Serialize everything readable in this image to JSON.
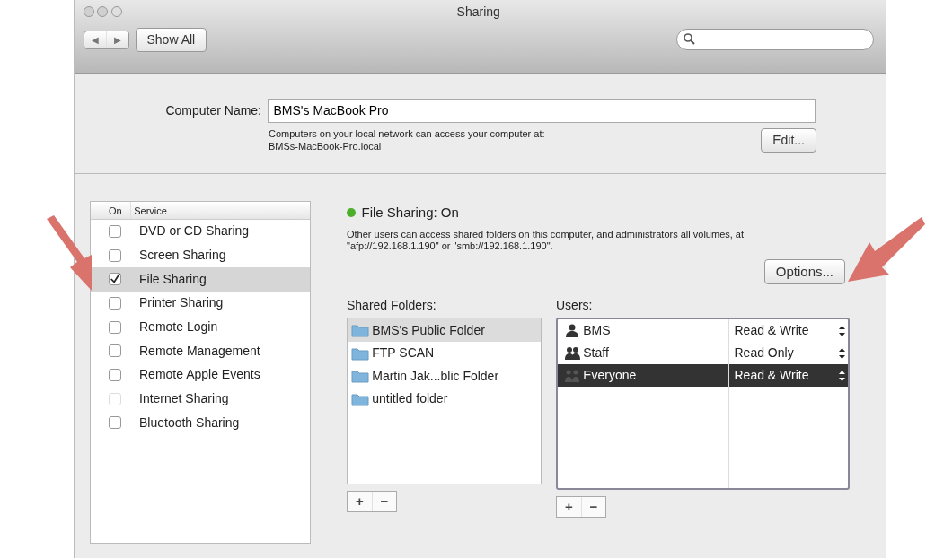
{
  "window": {
    "title": "Sharing"
  },
  "toolbar": {
    "back": "◀",
    "forward": "▶",
    "show_all": "Show All"
  },
  "computer_name": {
    "label": "Computer Name:",
    "value": "BMS's MacBook Pro",
    "note": "Computers on your local network can access your computer at:",
    "address": "BMSs-MacBook-Pro.local",
    "edit": "Edit..."
  },
  "services": {
    "columns": [
      "On",
      "Service"
    ],
    "items": [
      {
        "name": "DVD or CD Sharing",
        "checked": false,
        "selected": false,
        "disabled": false
      },
      {
        "name": "Screen Sharing",
        "checked": false,
        "selected": false,
        "disabled": false
      },
      {
        "name": "File Sharing",
        "checked": true,
        "selected": true,
        "disabled": false
      },
      {
        "name": "Printer Sharing",
        "checked": false,
        "selected": false,
        "disabled": false
      },
      {
        "name": "Remote Login",
        "checked": false,
        "selected": false,
        "disabled": false
      },
      {
        "name": "Remote Management",
        "checked": false,
        "selected": false,
        "disabled": false
      },
      {
        "name": "Remote Apple Events",
        "checked": false,
        "selected": false,
        "disabled": false
      },
      {
        "name": "Internet Sharing",
        "checked": false,
        "selected": false,
        "disabled": true
      },
      {
        "name": "Bluetooth Sharing",
        "checked": false,
        "selected": false,
        "disabled": false
      }
    ]
  },
  "status": {
    "text": "File Sharing: On",
    "on": true,
    "description": "Other users can access shared folders on this computer, and administrators all volumes, at \"afp://192.168.1.190\" or \"smb://192.168.1.190\".",
    "options": "Options..."
  },
  "shared_folders": {
    "label": "Shared Folders:",
    "items": [
      {
        "name": "BMS's Public Folder",
        "selected": true
      },
      {
        "name": "FTP SCAN",
        "selected": false
      },
      {
        "name": "Martin Jak...blic Folder",
        "selected": false
      },
      {
        "name": "untitled folder",
        "selected": false
      }
    ],
    "add": "+",
    "remove": "−"
  },
  "users": {
    "label": "Users:",
    "items": [
      {
        "name": "BMS",
        "kind": "person",
        "access": "Read & Write",
        "selected": false
      },
      {
        "name": "Staff",
        "kind": "group",
        "access": "Read Only",
        "selected": false
      },
      {
        "name": "Everyone",
        "kind": "everyone",
        "access": "Read & Write",
        "selected": true
      }
    ],
    "add": "+",
    "remove": "−"
  }
}
